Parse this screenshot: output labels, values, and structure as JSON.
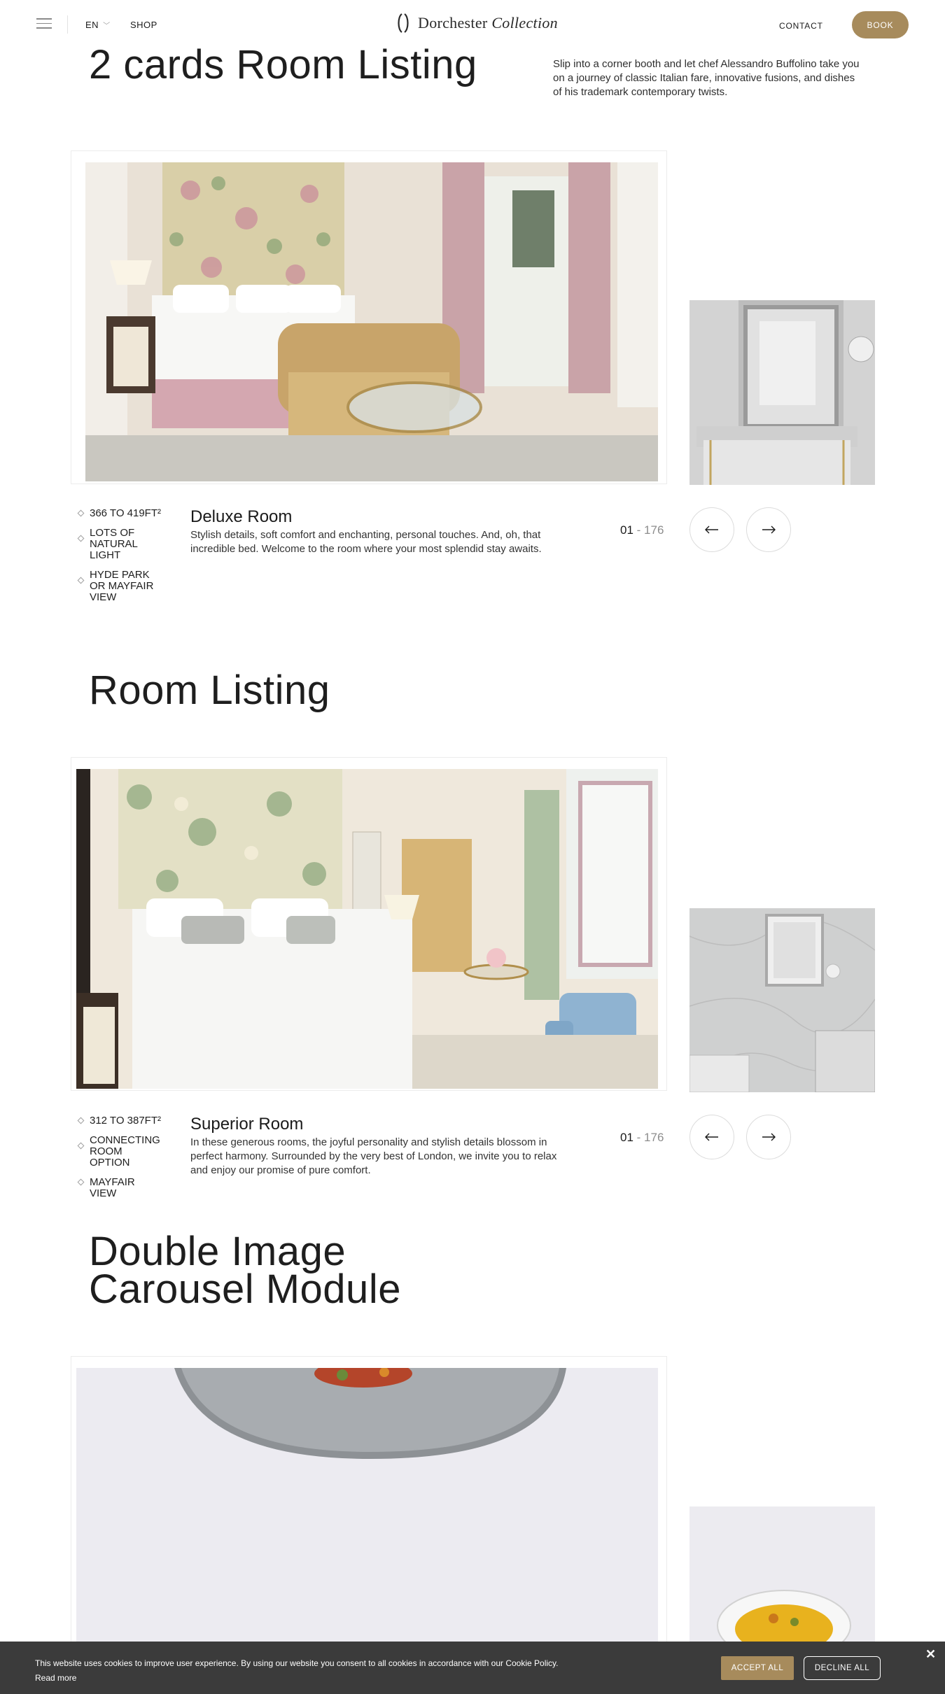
{
  "header": {
    "lang": "EN",
    "shop": "SHOP",
    "logo_main": "Dorchester",
    "logo_italic": "Collection",
    "contact": "CONTACT",
    "book": "BOOK"
  },
  "section1": {
    "title": "2 cards Room Listing",
    "intro": "Slip into a corner booth and let chef Alessandro Buffolino take you on a journey of classic Italian fare, innovative fusions, and dishes of his trademark contemporary twists.",
    "features": [
      "366 TO 419FT²",
      "LOTS OF NATURAL LIGHT",
      "HYDE PARK OR MAYFAIR VIEW"
    ],
    "room_name": "Deluxe Room",
    "room_desc": "Stylish details, soft comfort and enchanting, personal touches. And, oh, that incredible bed. Welcome to the room where your most splendid stay awaits.",
    "counter_current": "01",
    "counter_sep": " - ",
    "counter_total": "176"
  },
  "section2": {
    "title": "Room Listing",
    "features": [
      "312 TO 387FT²",
      "CONNECTING ROOM OPTION",
      "MAYFAIR VIEW"
    ],
    "room_name": "Superior Room",
    "room_desc": "In these generous rooms, the joyful personality and stylish details blossom in perfect harmony. Surrounded by the very best of London, we invite you to relax and enjoy our promise of pure comfort.",
    "counter_current": "01",
    "counter_sep": " - ",
    "counter_total": "176"
  },
  "section3": {
    "title_line1": "Double Image",
    "title_line2": "Carousel Module"
  },
  "cookie": {
    "text": "This website uses cookies to improve user experience. By using our website you consent to all cookies in accordance with our Cookie Policy.",
    "read_more": "Read more",
    "accept": "ACCEPT ALL",
    "decline": "DECLINE ALL",
    "close": "✕"
  },
  "icons": {
    "menu": "hamburger-icon",
    "chevron": "chevron-down-icon",
    "prev": "arrow-left-icon",
    "next": "arrow-right-icon",
    "close": "close-icon"
  },
  "colors": {
    "accent": "#a78b5c",
    "cookie_bg": "#3b3b3b"
  }
}
